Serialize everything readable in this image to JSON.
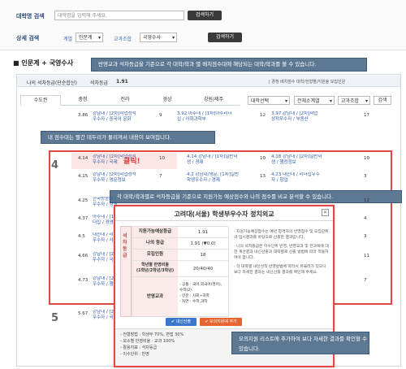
{
  "search": {
    "label": "대학명 검색",
    "placeholder": "대학명을 입력해 주세요.",
    "button": "검색하기"
  },
  "detail": {
    "label": "상세 검색",
    "field1_label": "계열",
    "field1_value": "인문계",
    "field2_label": "교과조합",
    "field2_value": "국영수사",
    "button": "검색하기"
  },
  "section": {
    "title": "인문계 + 국영수사"
  },
  "callouts": {
    "top": "반영교과 석차등급을 기준으로 각 대학/학과 별 배치점수대에 해당되는 대학/학과를 볼 수 있습니다.",
    "score": "내 점수대는 빨간 테두리가 둘러져서 내용이 보여집니다.",
    "compare": "각 대학/학과별로 석차등급을 기준으로 지원가능 예상점수와 나의 점수를 비교 분석할 수 있습니다.",
    "bottom": "모의지원 리스트에 추가하여 보다 자세한 결과를 확인할 수 있습니다."
  },
  "grade_bar": {
    "label": "나의 석차등급(단순합산)",
    "grade_label": "석차등급",
    "grade_value": "1.91",
    "links": "| 경쟁 배치점수 대학/전형별/지원율 모집인원"
  },
  "tabs": [
    "수도권",
    "충청",
    "전라",
    "경상",
    "강원/제주"
  ],
  "filters": [
    "대학선택",
    "전체소계열",
    "교과조합",
    "검색"
  ],
  "rows_top": [
    {
      "score": "3.86",
      "a": "강남대 / [2차]학업성적\n우수자 / 중국어 문화",
      "s2": "9",
      "b": "3.92 아주대 / [1차]아주리더\n십 / 사회과학부",
      "c": "12",
      "d": "3.97 강남대 / [2차]학업\n성적우수자 / 부동산",
      "e": "17"
    }
  ],
  "groups": [
    {
      "label": "4",
      "rows": [
        {
          "score": "4.14",
          "a": "강남대 / [2차]학업성적\n우수자 / 국제",
          "s2": "10",
          "b": "4.14 강남대 / [1차]일반학\n생 / 경제",
          "c": "10",
          "d": "4.18 강남대 / [2차]일반학\n생 / 행정정보",
          "e": "10"
        },
        {
          "score": "4.15",
          "a": "강남대 / [2차]학업성적\n우수자 / 영문정보",
          "s2": "7",
          "b": "4.2 강남대/영문, [1차]일반\n학생우수자 / 경제",
          "c": "13",
          "d": "4.23 대진대 / 리더십우수\n자 / 창업",
          "e": "3"
        },
        {
          "score": "4.25",
          "a": "한국방송대 / [2차]학업\n우수자 / 경영",
          "s2": "",
          "b": "",
          "c": "",
          "d": "",
          "e": "12"
        },
        {
          "score": "4.37",
          "a": "아주대 / [1차]아주리\n더십 / 경영",
          "s2": "",
          "b": "",
          "c": "",
          "d": "",
          "e": "4"
        },
        {
          "score": "4.5",
          "a": "대진대 / 리더십\n우수자 / 사회",
          "s2": "",
          "b": "",
          "c": "",
          "d": "",
          "e": "3"
        },
        {
          "score": "4.66",
          "a": "강남대 / [2차]학업\n우수자 / 국제",
          "s2": "",
          "b": "",
          "c": "",
          "d": "",
          "e": "11"
        },
        {
          "score": "4.73",
          "a": "강남대 / [2차]학업\n우수자 / 행정",
          "s2": "",
          "b": "",
          "c": "",
          "d": "",
          "e": "7"
        }
      ]
    },
    {
      "label": "5",
      "rows": [
        {
          "score": "5.67",
          "a": "강남대 / [2차]학업성적\n우수자 / 국제",
          "s2": "14",
          "b": "",
          "c": "",
          "d": "",
          "e": ""
        }
      ]
    }
  ],
  "click_label": "클릭!",
  "modal": {
    "title": "고려대(서울) 학생부우수자 정치외교",
    "side_label": "석차 등급",
    "rows": [
      {
        "k": "지원가능예상등급",
        "v": "1.91"
      },
      {
        "k": "나의 등급",
        "v": "1.91 (▼0.0)"
      },
      {
        "k": "모집인원",
        "v": "18"
      },
      {
        "k": "학년별 반영비율\n(1학년/2학년/3학년)",
        "v": "20/40/40"
      },
      {
        "k": "반영교과",
        "v": "- 공통 : 국어,외국어(영어),\n수학(2)\n- 인문 : 사회+과학\n- 자연 : 수학,과학"
      }
    ],
    "notes": [
      "· 지원가능예상점수는 예년 합격자의 반영점수 및 모집단위의 입시결과를 바탕으로 산출한 결과입니다.",
      "· 나의 석차등급은 이수단위 반영, 반영교과 및 전과목에 대한 계산결과 내신산출과 대학별로 산출 방법에 따라 적용하여야 합니다.",
      "· 각 대학별 내신성적 반영방법에 따라서 유불리가 있으니 보다 자세한 결과는 내신산출 결과를 확인해 주세요."
    ],
    "btn_print": "✔ 내신산출",
    "btn_add": "✔ 모의지원에 추가",
    "footer": [
      "- 전형방법 : 학생부 70%, 면접 30%",
      "- 모소별 반영비율 : 교과 100%",
      "- 활용지표 : 석차등급",
      "- 이수단위 : 반영"
    ]
  },
  "colors": {
    "accent": "#3a6fb8",
    "callout": "#5d7893",
    "highlight": "#e84545"
  }
}
